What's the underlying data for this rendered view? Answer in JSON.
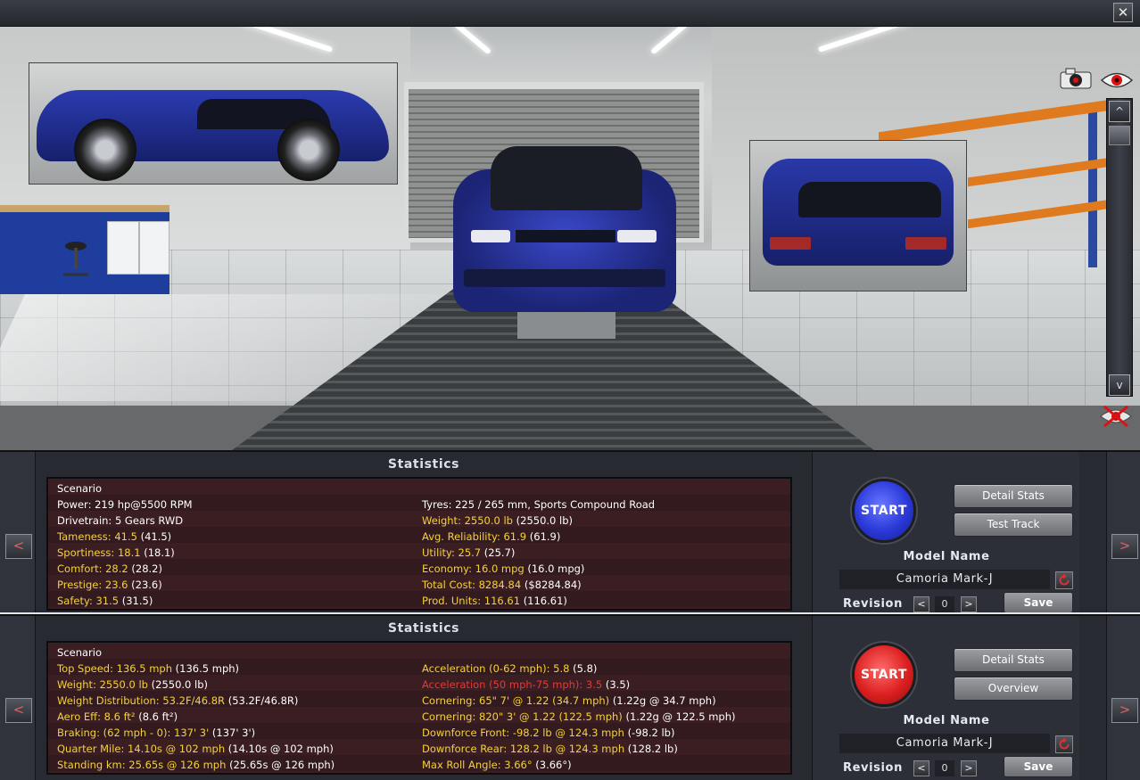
{
  "window": {
    "close_glyph": "✕"
  },
  "viewport": {
    "icons": [
      "camera-icon",
      "eye-icon",
      "hide-view-icon"
    ],
    "scroll": {
      "up_glyph": "^",
      "down_glyph": "v"
    }
  },
  "colors": {
    "start_primary": "#2a38d8",
    "start_secondary": "#dc1f1f",
    "stat_value": "#f5d13a",
    "stat_warning": "#e23a3a"
  },
  "panels": [
    {
      "title": "Statistics",
      "nav": {
        "prev_glyph": "<",
        "next_glyph": ">"
      },
      "stats": {
        "header": "Scenario",
        "left": [
          {
            "label": "Power: 219 hp@5500 RPM",
            "prev": "",
            "style": "plain"
          },
          {
            "label": "Drivetrain: 5 Gears RWD",
            "prev": "",
            "style": "plain"
          },
          {
            "label": "Tameness: 41.5",
            "prev": "(41.5)",
            "style": "value"
          },
          {
            "label": "Sportiness: 18.1",
            "prev": "(18.1)",
            "style": "value"
          },
          {
            "label": "Comfort: 28.2",
            "prev": "(28.2)",
            "style": "value"
          },
          {
            "label": "Prestige: 23.6",
            "prev": "(23.6)",
            "style": "value"
          },
          {
            "label": "Safety: 31.5",
            "prev": "(31.5)",
            "style": "value"
          }
        ],
        "right": [
          {
            "label": "Tyres: 225 / 265 mm, Sports Compound Road",
            "prev": "",
            "style": "plain"
          },
          {
            "label": "Weight: 2550.0 lb",
            "prev": "(2550.0 lb)",
            "style": "value"
          },
          {
            "label": "Avg. Reliability: 61.9",
            "prev": "(61.9)",
            "style": "value"
          },
          {
            "label": "Utility: 25.7",
            "prev": "(25.7)",
            "style": "value"
          },
          {
            "label": "Economy: 16.0 mpg",
            "prev": "(16.0 mpg)",
            "style": "value"
          },
          {
            "label": "Total Cost: 8284.84",
            "prev": "($8284.84)",
            "style": "value"
          },
          {
            "label": "Prod. Units: 116.61",
            "prev": "(116.61)",
            "style": "value"
          }
        ]
      },
      "start_label": "START",
      "buttons": [
        "Detail Stats",
        "Test Track"
      ],
      "model_label": "Model Name",
      "model_name": "Camoria Mark-J",
      "revision_label": "Revision",
      "revision_value": "0",
      "save_label": "Save"
    },
    {
      "title": "Statistics",
      "nav": {
        "prev_glyph": "<",
        "next_glyph": ">"
      },
      "stats": {
        "header": "Scenario",
        "left": [
          {
            "label": "Top Speed: 136.5 mph",
            "prev": "(136.5 mph)",
            "style": "value"
          },
          {
            "label": "Weight: 2550.0 lb",
            "prev": "(2550.0 lb)",
            "style": "value"
          },
          {
            "label": "Weight Distribution: 53.2F/46.8R",
            "prev": "(53.2F/46.8R)",
            "style": "value"
          },
          {
            "label": "Aero Eff: 8.6 ft²",
            "prev": "(8.6 ft²)",
            "style": "value"
          },
          {
            "label": "Braking: (62 mph - 0): 137' 3'",
            "prev": "(137' 3')",
            "style": "value"
          },
          {
            "label": "Quarter Mile: 14.10s @ 102 mph",
            "prev": "(14.10s @ 102 mph)",
            "style": "value"
          },
          {
            "label": "Standing km: 25.65s @ 126 mph",
            "prev": "(25.65s @ 126 mph)",
            "style": "value"
          }
        ],
        "right": [
          {
            "label": "Acceleration (0-62 mph): 5.8",
            "prev": "(5.8)",
            "style": "value"
          },
          {
            "label": "Acceleration (50 mph-75 mph): 3.5",
            "prev": "(3.5)",
            "style": "warning"
          },
          {
            "label": "Cornering: 65\" 7' @ 1.22 (34.7 mph)",
            "prev": "(1.22g @ 34.7 mph)",
            "style": "value"
          },
          {
            "label": "Cornering: 820\" 3' @ 1.22 (122.5 mph)",
            "prev": "(1.22g @ 122.5 mph)",
            "style": "value"
          },
          {
            "label": "Downforce Front: -98.2 lb @ 124.3 mph",
            "prev": "(-98.2 lb)",
            "style": "value"
          },
          {
            "label": "Downforce Rear: 128.2 lb @ 124.3 mph",
            "prev": "(128.2 lb)",
            "style": "value"
          },
          {
            "label": "Max Roll Angle: 3.66°",
            "prev": "(3.66°)",
            "style": "value"
          }
        ]
      },
      "start_label": "START",
      "buttons": [
        "Detail Stats",
        "Overview"
      ],
      "model_label": "Model Name",
      "model_name": "Camoria Mark-J",
      "revision_label": "Revision",
      "revision_value": "0",
      "save_label": "Save"
    }
  ]
}
